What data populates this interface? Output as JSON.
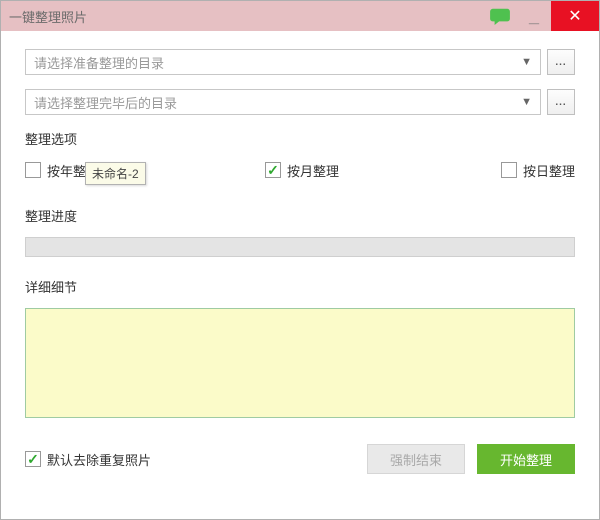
{
  "window": {
    "title": "一键整理照片"
  },
  "paths": {
    "source_placeholder": "请选择准备整理的目录",
    "dest_placeholder": "请选择整理完毕后的目录",
    "browse_label": "..."
  },
  "options": {
    "section_label": "整理选项",
    "by_year": {
      "label": "按年整理",
      "checked": false
    },
    "by_month": {
      "label": "按月整理",
      "checked": true
    },
    "by_day": {
      "label": "按日整理",
      "checked": false
    },
    "tooltip": "未命名-2"
  },
  "progress": {
    "section_label": "整理进度"
  },
  "details": {
    "section_label": "详细细节"
  },
  "footer": {
    "dedupe": {
      "label": "默认去除重复照片",
      "checked": true
    },
    "force_stop": "强制结束",
    "start": "开始整理"
  }
}
